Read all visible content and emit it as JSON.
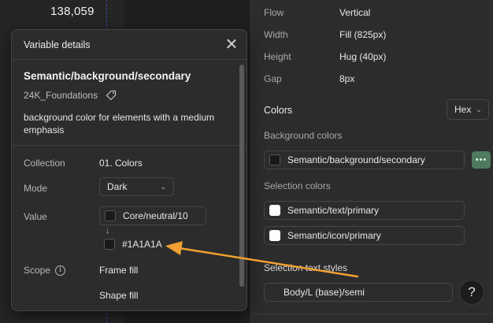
{
  "canvas": {
    "value_text": "138,059"
  },
  "right_panel": {
    "properties": [
      {
        "label": "Flow",
        "value": "Vertical"
      },
      {
        "label": "Width",
        "value": "Fill (825px)"
      },
      {
        "label": "Height",
        "value": "Hug (40px)"
      },
      {
        "label": "Gap",
        "value": "8px"
      }
    ],
    "colors_title": "Colors",
    "color_format": "Hex",
    "background_colors_title": "Background colors",
    "background_colors": [
      {
        "name": "Semantic/background/secondary",
        "swatch": "#1A1A1A"
      }
    ],
    "more_label": "•••",
    "selection_colors_title": "Selection colors",
    "selection_colors": [
      {
        "name": "Semantic/text/primary",
        "swatch": "#FFFFFF"
      },
      {
        "name": "Semantic/icon/primary",
        "swatch": "#FFFFFF"
      }
    ],
    "selection_text_styles_title": "Selection text styles",
    "text_style": "Body/L (base)/semi",
    "help_label": "?"
  },
  "modal": {
    "title": "Variable details",
    "variable_name": "Semantic/background/secondary",
    "library": "24K_Foundations",
    "description": "background color for elements with a medium emphasis",
    "collection_label": "Collection",
    "collection_value": "01. Colors",
    "mode_label": "Mode",
    "mode_value": "Dark",
    "value_label": "Value",
    "alias_value": "Core/neutral/10",
    "resolved_arrow": "↓",
    "resolved_hex": "#1A1A1A",
    "scope_label": "Scope",
    "scopes": [
      "Frame fill",
      "Shape fill"
    ]
  },
  "colors": {
    "annotation_arrow": "#F0A030",
    "accent_green": "#4E7A5E",
    "guide_blue": "#3B5BDB"
  }
}
